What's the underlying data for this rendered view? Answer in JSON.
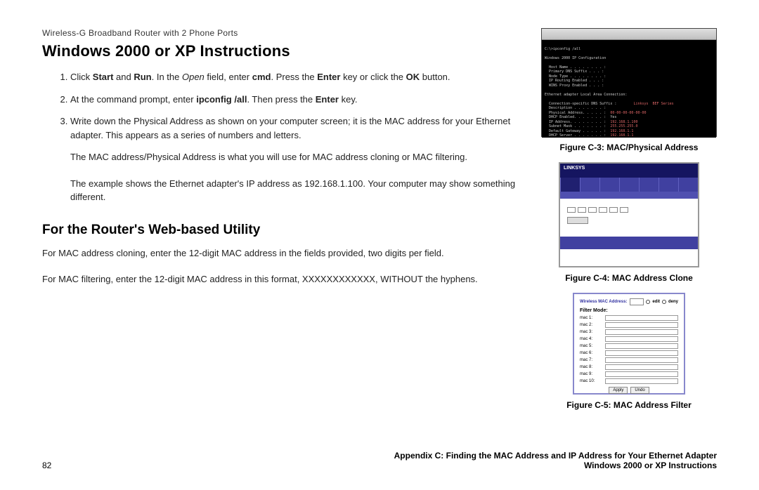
{
  "breadcrumb": "Wireless-G Broadband Router with 2 Phone Ports",
  "h1": "Windows 2000 or XP Instructions",
  "steps": {
    "s1a": "Click ",
    "s1b": "Start",
    "s1c": " and ",
    "s1d": "Run",
    "s1e": ". In the ",
    "s1f": "Open",
    "s1g": " field, enter ",
    "s1h": "cmd",
    "s1i": ". Press the ",
    "s1j": "Enter",
    "s1k": " key or click the ",
    "s1l": "OK",
    "s1m": " button.",
    "s2a": "At the command prompt, enter ",
    "s2b": "ipconfig /all",
    "s2c": ". Then press the ",
    "s2d": "Enter",
    "s2e": " key.",
    "s3": "Write down the Physical Address as shown on your computer screen; it is the MAC address for your Ethernet adapter. This appears as a series of numbers and letters."
  },
  "p1": "The MAC address/Physical Address is what you will use for MAC address cloning or MAC filtering.",
  "p2": "The example shows the Ethernet adapter's IP address as 192.168.1.100. Your computer may show something different.",
  "h2": "For the Router's Web-based Utility",
  "p3": "For MAC address cloning, enter the 12-digit MAC address in the fields provided, two digits per field.",
  "p4": "For MAC filtering, enter the 12-digit MAC address in this format, XXXXXXXXXXXX, WITHOUT the hyphens.",
  "fig3_caption": "Figure C-3: MAC/Physical Address",
  "fig4_caption": "Figure C-4: MAC Address Clone",
  "fig5_caption": "Figure C-5: MAC Address Filter",
  "router_brand": "LINKSYS",
  "filter_rows": [
    "mac 1:",
    "mac 2:",
    "mac 3:",
    "mac 4:",
    "mac 5:",
    "mac 6:",
    "mac 7:",
    "mac 8:",
    "mac 9:",
    "mac 10:"
  ],
  "filter_header_left": "Wireless MAC Address:",
  "filter_header_edit": "edit",
  "filter_header_deny": "deny",
  "filter_sub": "Filter Mode:",
  "filter_apply": "Apply",
  "filter_undo": "Undo",
  "page_number": "82",
  "footer_appendix": "Appendix C: Finding the MAC Address and IP Address for Your Ethernet Adapter",
  "footer_sub": "Windows 2000 or XP Instructions"
}
